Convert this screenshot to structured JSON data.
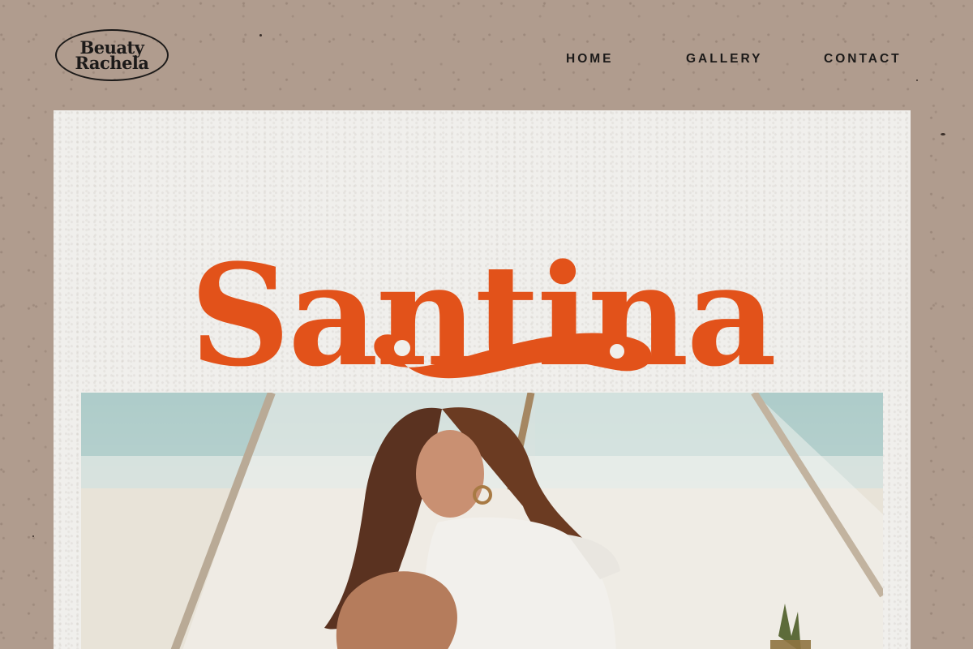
{
  "brand": {
    "logo_line1": "Beuaty",
    "logo_line2": "Rachela"
  },
  "nav": {
    "items": [
      "HOME",
      "GALLERY",
      "CONTACT"
    ]
  },
  "hero": {
    "title": "Santina"
  },
  "colors": {
    "background": "#b09c8e",
    "paper": "#f0efec",
    "accent": "#e2521a",
    "ink": "#1c1a19"
  }
}
